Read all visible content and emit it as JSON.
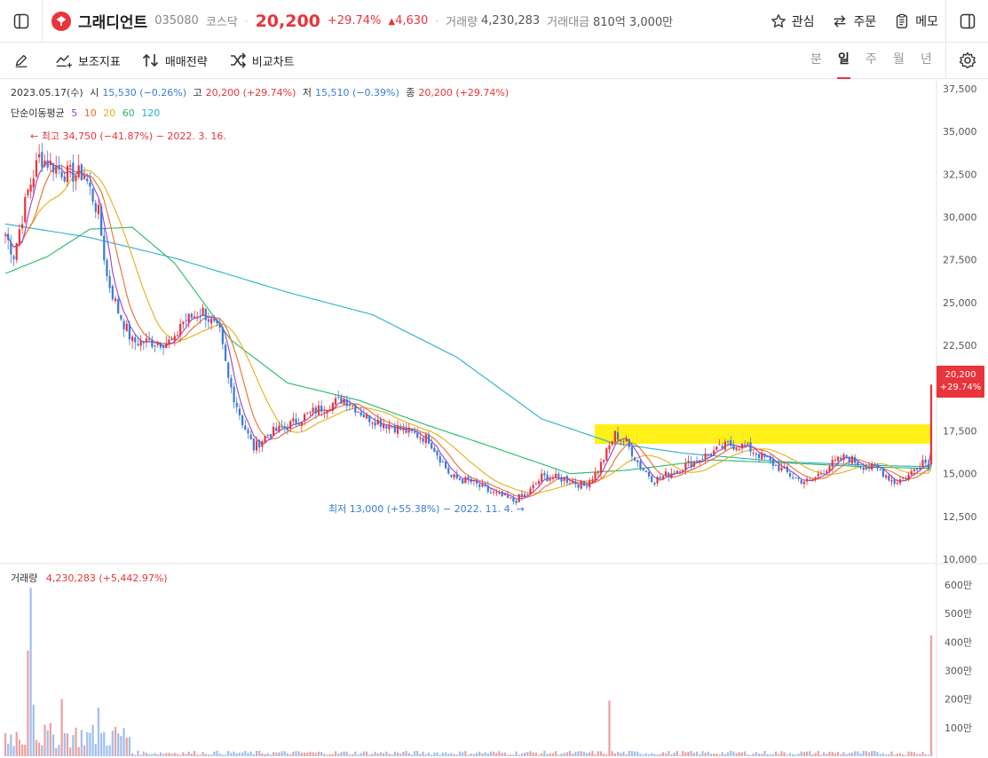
{
  "header": {
    "stock_name": "그래디언트",
    "code": "035080",
    "market": "코스닥",
    "price": "20,200",
    "change_pct": "+29.74%",
    "change_abs": "4,630",
    "volume_label": "거래량",
    "volume": "4,230,283",
    "amount_label": "거래대금",
    "amount": "810억 3,000만",
    "actions": {
      "watch": "관심",
      "order": "주문",
      "memo": "메모"
    }
  },
  "toolbar": {
    "indicator": "보조지표",
    "strategy": "매매전략",
    "compare": "비교차트",
    "periods": [
      "분",
      "일",
      "주",
      "월",
      "년"
    ],
    "active_period": "일"
  },
  "ohlc": {
    "date": "2023.05.17(수)",
    "open_label": "시",
    "open": "15,530 (−0.26%)",
    "high_label": "고",
    "high": "20,200 (+29.74%)",
    "low_label": "저",
    "low": "15,510 (−0.39%)",
    "close_label": "종",
    "close": "20,200 (+29.74%)"
  },
  "ma_legend": {
    "label": "단순이동평균",
    "periods": [
      {
        "n": "5",
        "color": "#9b3fd6"
      },
      {
        "n": "10",
        "color": "#ef6a2b"
      },
      {
        "n": "20",
        "color": "#e6b012"
      },
      {
        "n": "60",
        "color": "#27b86a"
      },
      {
        "n": "120",
        "color": "#27b0cc"
      }
    ]
  },
  "annotations": {
    "high": "← 최고 34,750 (−41.87%) − 2022. 3. 16.",
    "low": "최저 13,000 (+55.38%) − 2022. 11. 4. →"
  },
  "price_tag": {
    "price": "20,200",
    "change": "+29.74%"
  },
  "volume_panel": {
    "label": "거래량",
    "value": "4,230,283 (+5,442.97%)"
  },
  "colors": {
    "up": "#e8343a",
    "down": "#3a7bd5",
    "highlight": "#ffee00"
  },
  "chart_data": {
    "type": "candlestick",
    "price_axis": {
      "ticks": [
        "37,500",
        "35,000",
        "32,500",
        "30,000",
        "27,500",
        "25,000",
        "22,500",
        "17,500",
        "15,000",
        "12,500",
        "10,000"
      ],
      "ylim": [
        10000,
        37500
      ]
    },
    "volume_axis": {
      "ticks": [
        "600만",
        "500만",
        "400만",
        "300만",
        "200만",
        "100만"
      ]
    },
    "key_points": [
      {
        "label": "최고",
        "value": 34750,
        "date": "2022. 3. 16."
      },
      {
        "label": "최저",
        "value": 13000,
        "date": "2022. 11. 4."
      },
      {
        "label": "현재가",
        "value": 20200,
        "date": "2023.05.17"
      }
    ],
    "close_path_anchors": [
      {
        "i": 0,
        "v": 29000
      },
      {
        "i": 3,
        "v": 27800
      },
      {
        "i": 8,
        "v": 31500
      },
      {
        "i": 12,
        "v": 33500
      },
      {
        "i": 22,
        "v": 32500
      },
      {
        "i": 28,
        "v": 32500
      },
      {
        "i": 33,
        "v": 30200
      },
      {
        "i": 36,
        "v": 26500
      },
      {
        "i": 40,
        "v": 24500
      },
      {
        "i": 45,
        "v": 22700
      },
      {
        "i": 60,
        "v": 22700
      },
      {
        "i": 62,
        "v": 23800
      },
      {
        "i": 70,
        "v": 24500
      },
      {
        "i": 76,
        "v": 23200
      },
      {
        "i": 79,
        "v": 20500
      },
      {
        "i": 84,
        "v": 18000
      },
      {
        "i": 88,
        "v": 16500
      },
      {
        "i": 93,
        "v": 17300
      },
      {
        "i": 100,
        "v": 17800
      },
      {
        "i": 110,
        "v": 18700
      },
      {
        "i": 120,
        "v": 19400
      },
      {
        "i": 128,
        "v": 18300
      },
      {
        "i": 140,
        "v": 17600
      },
      {
        "i": 150,
        "v": 17000
      },
      {
        "i": 158,
        "v": 14800
      },
      {
        "i": 165,
        "v": 14500
      },
      {
        "i": 172,
        "v": 13900
      },
      {
        "i": 180,
        "v": 13400
      },
      {
        "i": 185,
        "v": 13800
      },
      {
        "i": 190,
        "v": 14800
      },
      {
        "i": 198,
        "v": 14700
      },
      {
        "i": 205,
        "v": 14300
      },
      {
        "i": 210,
        "v": 15200
      },
      {
        "i": 216,
        "v": 17300
      },
      {
        "i": 220,
        "v": 16800
      },
      {
        "i": 225,
        "v": 15400
      },
      {
        "i": 230,
        "v": 14600
      },
      {
        "i": 240,
        "v": 15400
      },
      {
        "i": 250,
        "v": 16200
      },
      {
        "i": 256,
        "v": 16700
      },
      {
        "i": 262,
        "v": 16600
      },
      {
        "i": 270,
        "v": 15800
      },
      {
        "i": 280,
        "v": 14700
      },
      {
        "i": 285,
        "v": 14500
      },
      {
        "i": 292,
        "v": 15500
      },
      {
        "i": 298,
        "v": 16000
      },
      {
        "i": 303,
        "v": 15500
      },
      {
        "i": 310,
        "v": 15200
      },
      {
        "i": 315,
        "v": 14500
      },
      {
        "i": 320,
        "v": 14900
      },
      {
        "i": 325,
        "v": 15800
      },
      {
        "i": 327,
        "v": 15500
      },
      {
        "i": 328,
        "v": 20200
      }
    ],
    "ma120_anchors": [
      {
        "i": 0,
        "v": 29600
      },
      {
        "i": 30,
        "v": 28800
      },
      {
        "i": 60,
        "v": 27600
      },
      {
        "i": 100,
        "v": 25600
      },
      {
        "i": 130,
        "v": 24300
      },
      {
        "i": 160,
        "v": 21800
      },
      {
        "i": 190,
        "v": 18200
      },
      {
        "i": 215,
        "v": 16800
      },
      {
        "i": 240,
        "v": 16200
      },
      {
        "i": 275,
        "v": 15700
      },
      {
        "i": 305,
        "v": 15500
      },
      {
        "i": 328,
        "v": 15400
      }
    ],
    "ma60_anchors": [
      {
        "i": 0,
        "v": 26700
      },
      {
        "i": 15,
        "v": 27700
      },
      {
        "i": 30,
        "v": 29300
      },
      {
        "i": 45,
        "v": 29400
      },
      {
        "i": 60,
        "v": 27300
      },
      {
        "i": 80,
        "v": 22800
      },
      {
        "i": 100,
        "v": 20300
      },
      {
        "i": 125,
        "v": 19300
      },
      {
        "i": 150,
        "v": 17800
      },
      {
        "i": 170,
        "v": 16700
      },
      {
        "i": 200,
        "v": 15000
      },
      {
        "i": 220,
        "v": 15200
      },
      {
        "i": 250,
        "v": 15800
      },
      {
        "i": 280,
        "v": 15600
      },
      {
        "i": 305,
        "v": 15400
      },
      {
        "i": 328,
        "v": 15300
      }
    ],
    "volume_spikes": [
      {
        "i": 8,
        "v": 3700000,
        "up": true
      },
      {
        "i": 9,
        "v": 5900000,
        "up": false
      },
      {
        "i": 10,
        "v": 1800000,
        "up": false
      },
      {
        "i": 20,
        "v": 2000000,
        "up": true
      },
      {
        "i": 33,
        "v": 1700000,
        "up": false
      },
      {
        "i": 214,
        "v": 1950000,
        "up": true
      },
      {
        "i": 328,
        "v": 4230283,
        "up": true
      }
    ]
  }
}
